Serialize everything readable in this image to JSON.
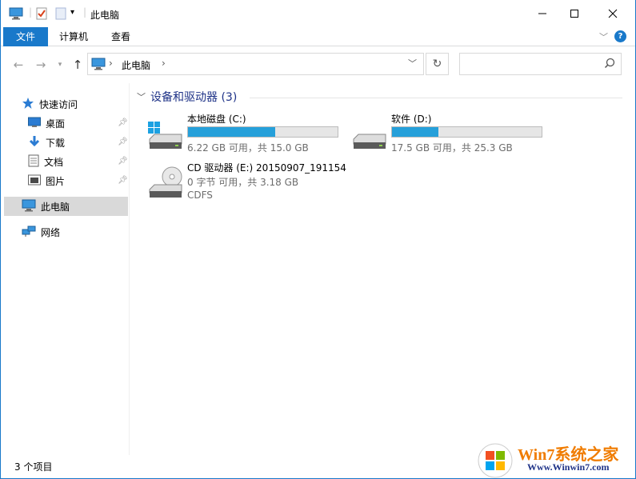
{
  "window": {
    "title": "此电脑",
    "controls": {
      "minimize": "minimize",
      "maximize": "maximize",
      "close": "close"
    }
  },
  "ribbon": {
    "tabs": [
      "文件",
      "计算机",
      "查看"
    ]
  },
  "address": {
    "location": "此电脑"
  },
  "navpane": {
    "quick_access": "快速访问",
    "items": [
      "桌面",
      "下载",
      "文档",
      "图片"
    ],
    "this_pc": "此电脑",
    "network": "网络"
  },
  "content": {
    "section_title": "设备和驱动器 (3)",
    "drives": [
      {
        "name": "本地磁盘 (C:)",
        "info": "6.22 GB 可用，共 15.0 GB",
        "used_fraction": 0.585
      },
      {
        "name": "软件 (D:)",
        "info": "17.5 GB 可用，共 25.3 GB",
        "used_fraction": 0.31
      },
      {
        "name": "CD 驱动器 (E:) 20150907_191154",
        "info": "0 字节 可用，共 3.18 GB",
        "fs": "CDFS"
      }
    ]
  },
  "status": {
    "item_count": "3 个项目"
  },
  "watermark": {
    "text": "Win7系统之家",
    "url": "Www.Winwin7.com"
  },
  "colors": {
    "accent": "#1979ca",
    "bar_fill": "#26a0da",
    "section_title": "#1e3287"
  }
}
